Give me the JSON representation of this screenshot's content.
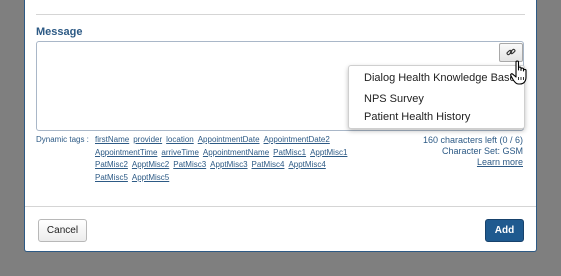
{
  "message": {
    "label": "Message",
    "value": ""
  },
  "insert_menu": {
    "items": [
      "Dialog Health Knowledge Base",
      "NPS Survey",
      "Patient Health History"
    ]
  },
  "dynamic_tags": {
    "label": "Dynamic tags :",
    "tags": [
      "firstName",
      "provider",
      "location",
      "AppointmentDate",
      "AppointmentDate2",
      "AppointmentTime",
      "arriveTime",
      "AppointmentName",
      "PatMisc1",
      "ApptMisc1",
      "PatMisc2",
      "ApptMisc2",
      "PatMisc3",
      "ApptMisc3",
      "PatMisc4",
      "ApptMisc4",
      "PatMisc5",
      "ApptMisc5"
    ]
  },
  "counter": {
    "chars_left": "160 characters left (0 / 6)",
    "charset": "Character Set: GSM",
    "learn_more": "Learn more"
  },
  "footer": {
    "cancel_label": "Cancel",
    "add_label": "Add"
  },
  "colors": {
    "accent": "#2d5a85",
    "primary_button": "#1f5a8f"
  }
}
